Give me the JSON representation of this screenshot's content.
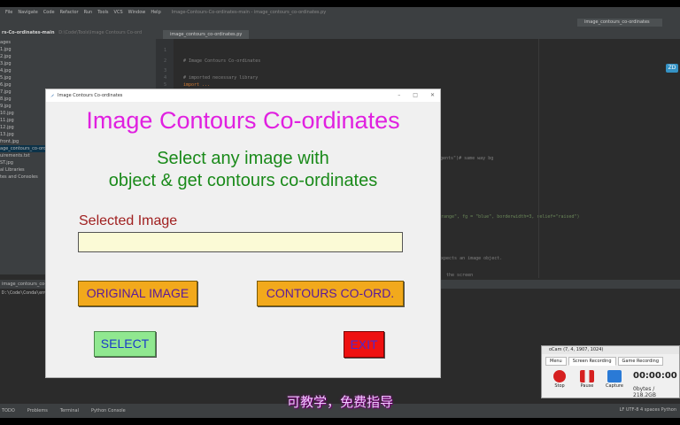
{
  "ide": {
    "menu": [
      "File",
      "Navigate",
      "Code",
      "Refactor",
      "Run",
      "Tools",
      "VCS",
      "Window",
      "Help"
    ],
    "title_path": "Image-Contours-Co-ordinates-main - image_contours_co-ordinates.py",
    "run_config": "image_contours_co-ordinates",
    "project_title": "rs-Co-ordinates-main",
    "project_path": "D:\\Code\\Tools\\Image Contours Co-ord",
    "project_items": [
      "ages",
      "1.jpg",
      "2.jpg",
      "3.jpg",
      "4.jpg",
      "5.jpg",
      "6.jpg",
      "7.jpg",
      "8.jpg",
      "9.jpg",
      "10.jpg",
      "11.jpg",
      "12.jpg",
      "13.jpg",
      "front.jpg",
      "age_contours_co-ordi",
      "uirements.txt",
      "ST.jpg",
      "al Libraries",
      "tes and Consoles"
    ],
    "editor_tab": "image_contours_co-ordinates.py",
    "code_lines": [
      "# Image Contours Co-ordinates",
      "# imported necessary library",
      "import ...",
      "ogents\")# same way bg",
      "range\", fg = \"blue\", borderwidth=3, relief=\"raised\")",
      "xpects an image object.",
      "the screen"
    ],
    "line_numbers": [
      "1",
      "2",
      "3",
      "4",
      "5",
      "6"
    ],
    "terminal_header": "image_contours_co-ordi",
    "terminal_text": "D:\\Code\\Conda\\env",
    "bottom_tabs": [
      "TODO",
      "Problems",
      "Terminal",
      "Python Console"
    ],
    "status_right": "LF  UTF-8  4 spaces  Python",
    "badge": "ZD"
  },
  "app": {
    "window_title": "Image Contours Co-ordinates",
    "heading": "Image Contours Co-ordinates",
    "sub1": "Select any image with",
    "sub2": "object & get contours co-ordinates",
    "selected_label": "Selected Image",
    "path_value": "",
    "btn_original": "ORIGINAL IMAGE",
    "btn_contours": "CONTOURS CO-ORD.",
    "btn_select": "SELECT",
    "btn_exit": "EXIT"
  },
  "ocam": {
    "title": "oCam (7, 4, 1907, 1024)",
    "tabs": [
      "Menu",
      "Screen Recording",
      "Game Recording"
    ],
    "controls": [
      "Stop",
      "Pause",
      "Capture"
    ],
    "time": "00:00:00",
    "size": "0bytes / 218.2GB"
  },
  "subtitle": "可教学，免费指导"
}
